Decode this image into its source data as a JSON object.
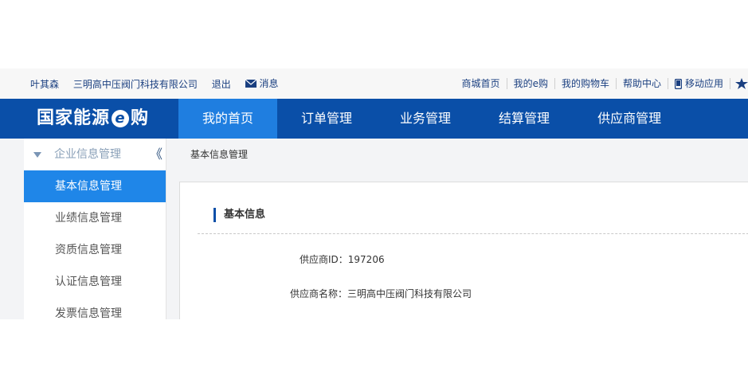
{
  "topbar": {
    "user": "叶其森",
    "company": "三明高中压阀门科技有限公司",
    "logout": "退出",
    "messages": "消息",
    "links": [
      "商城首页",
      "我的e购",
      "我的购物车",
      "帮助中心"
    ],
    "mobile": "移动应用"
  },
  "nav": {
    "logo_left": "国家能源",
    "logo_e": "e",
    "logo_right": "购",
    "tabs": [
      "我的首页",
      "订单管理",
      "业务管理",
      "结算管理",
      "供应商管理"
    ]
  },
  "sidebar": {
    "group": "企业信息管理",
    "items": [
      "基本信息管理",
      "业绩信息管理",
      "资质信息管理",
      "认证信息管理",
      "发票信息管理"
    ]
  },
  "breadcrumb": "基本信息管理",
  "section": {
    "title": "基本信息",
    "supplier_id_label": "供应商ID：",
    "supplier_id": "197206",
    "supplier_name_label": "供应商名称：",
    "supplier_name": "三明高中压阀门科技有限公司"
  },
  "colors": {
    "nav_bg": "#0a4fa8",
    "nav_active": "#1f7ee0",
    "side_active": "#1f86e8"
  }
}
